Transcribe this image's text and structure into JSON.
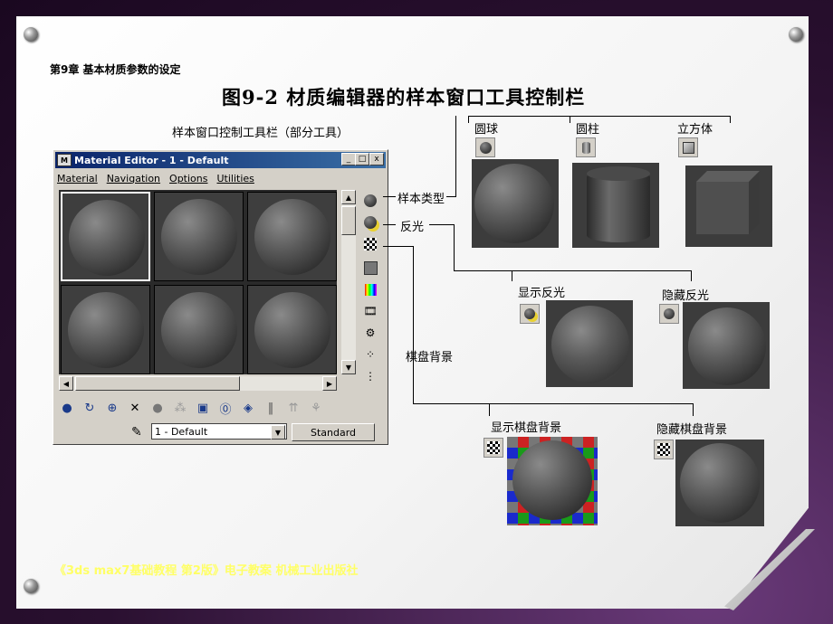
{
  "chapter": "第9章  基本材质参数的设定",
  "figure_title": "图9-2 材质编辑器的样本窗口工具控制栏",
  "toolbar_caption": "样本窗口控制工具栏（部分工具）",
  "footer": "《3ds max7基础教程 第2版》电子教案 机械工业出版社",
  "window": {
    "title": "Material Editor - 1 - Default",
    "title_icon": "M",
    "minimize": "_",
    "maximize": "□",
    "close": "x",
    "menus": [
      "Material",
      "Navigation",
      "Options",
      "Utilities"
    ],
    "material_name": "1 - Default",
    "type_button": "Standard"
  },
  "callouts": {
    "sample_type": "样本类型",
    "backlight": "反光",
    "background": "棋盘背景"
  },
  "sample_types": {
    "sphere": "圆球",
    "cylinder": "圆柱",
    "cube": "立方体"
  },
  "backlight_states": {
    "show": "显示反光",
    "hide": "隐藏反光"
  },
  "background_states": {
    "show": "显示棋盘背景",
    "hide": "隐藏棋盘背景"
  },
  "icons": {
    "sample_type": "sphere-icon",
    "backlight": "backlight-icon",
    "background": "checker-icon"
  }
}
